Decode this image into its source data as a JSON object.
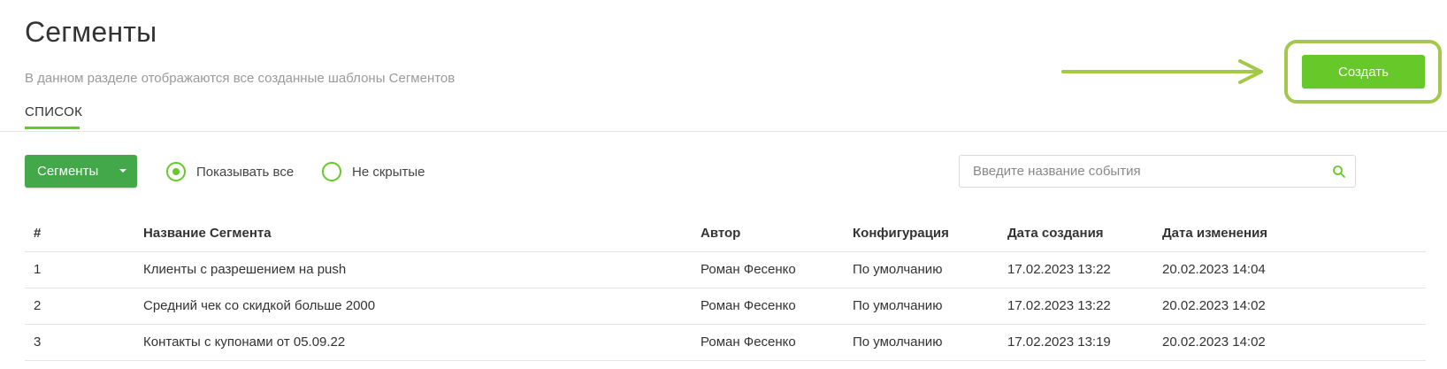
{
  "page": {
    "title": "Сегменты",
    "subtitle": "В данном разделе отображаются все созданные шаблоны Сегментов"
  },
  "tabs": [
    {
      "label": "СПИСОК",
      "active": true
    }
  ],
  "actions": {
    "create_label": "Создать"
  },
  "filters": {
    "dropdown_label": "Сегменты",
    "radio_all_label": "Показывать все",
    "radio_all_selected": true,
    "radio_visible_label": "Не скрытые",
    "radio_visible_selected": false
  },
  "search": {
    "placeholder": "Введите название события",
    "value": ""
  },
  "table": {
    "columns": [
      "#",
      "Название Сегмента",
      "Автор",
      "Конфигурация",
      "Дата создания",
      "Дата изменения"
    ],
    "rows": [
      [
        "1",
        "Клиенты с разрешением на push",
        "Роман Фесенко",
        "По умолчанию",
        "17.02.2023 13:22",
        "20.02.2023 14:04"
      ],
      [
        "2",
        "Средний чек со скидкой больше 2000",
        "Роман Фесенко",
        "По умолчанию",
        "17.02.2023 13:22",
        "20.02.2023 14:02"
      ],
      [
        "3",
        "Контакты с купонами от 05.09.22",
        "Роман Фесенко",
        "По умолчанию",
        "17.02.2023 13:19",
        "20.02.2023 14:02"
      ]
    ]
  },
  "colors": {
    "accent": "#67c82a",
    "dropdown_bg": "#43a84a",
    "highlight": "#a3c84b"
  },
  "icons": {
    "search": "search-icon",
    "caret": "chevron-down-icon",
    "arrow": "arrow-right-icon"
  }
}
